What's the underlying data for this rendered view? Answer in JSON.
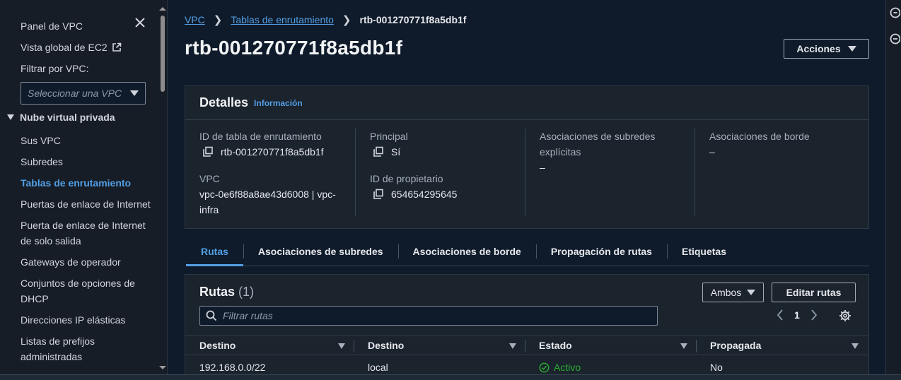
{
  "sidebar": {
    "vpc_dashboard": "Panel de VPC",
    "ec2_global_view": "Vista global de EC2",
    "filter_label": "Filtrar por VPC:",
    "filter_placeholder": "Seleccionar una VPC",
    "section_title": "Nube virtual privada",
    "items": [
      {
        "label": "Sus VPC",
        "active": false
      },
      {
        "label": "Subredes",
        "active": false
      },
      {
        "label": "Tablas de enrutamiento",
        "active": true
      },
      {
        "label": "Puertas de enlace de Internet",
        "active": false
      },
      {
        "label": "Puerta de enlace de Internet de solo salida",
        "active": false
      },
      {
        "label": "Gateways de operador",
        "active": false
      },
      {
        "label": "Conjuntos de opciones de DHCP",
        "active": false
      },
      {
        "label": "Direcciones IP elásticas",
        "active": false
      },
      {
        "label": "Listas de prefijos administradas",
        "active": false
      }
    ]
  },
  "breadcrumb": {
    "root": "VPC",
    "parent": "Tablas de enrutamiento",
    "current": "rtb-001270771f8a5db1f"
  },
  "page": {
    "title": "rtb-001270771f8a5db1f",
    "actions_label": "Acciones"
  },
  "details": {
    "title": "Detalles",
    "info_link": "Información",
    "route_table_id_label": "ID de tabla de enrutamiento",
    "route_table_id": "rtb-001270771f8a5db1f",
    "vpc_label": "VPC",
    "vpc_value": "vpc-0e6f88a8ae43d6008 | vpc-infra",
    "main_label": "Principal",
    "main_value": "Sí",
    "owner_label": "ID de propietario",
    "owner_value": "654654295645",
    "explicit_assoc_label": "Asociaciones de subredes explícitas",
    "explicit_assoc_value": "–",
    "edge_assoc_label": "Asociaciones de borde",
    "edge_assoc_value": "–"
  },
  "tabs": [
    {
      "label": "Rutas",
      "active": true
    },
    {
      "label": "Asociaciones de subredes",
      "active": false
    },
    {
      "label": "Asociaciones de borde",
      "active": false
    },
    {
      "label": "Propagación de rutas",
      "active": false
    },
    {
      "label": "Etiquetas",
      "active": false
    }
  ],
  "routes": {
    "title": "Rutas",
    "count": "(1)",
    "ambos_label": "Ambos",
    "edit_label": "Editar rutas",
    "filter_placeholder": "Filtrar rutas",
    "page": "1",
    "columns": [
      "Destino",
      "Destino",
      "Estado",
      "Propagada"
    ],
    "rows": [
      {
        "destination": "192.168.0.0/22",
        "target": "local",
        "status": "Activo",
        "propagated": "No"
      }
    ]
  },
  "colors": {
    "accent": "#539fe5",
    "success": "#29ad32",
    "background": "#0f1b2a",
    "panel": "#1b232d"
  }
}
